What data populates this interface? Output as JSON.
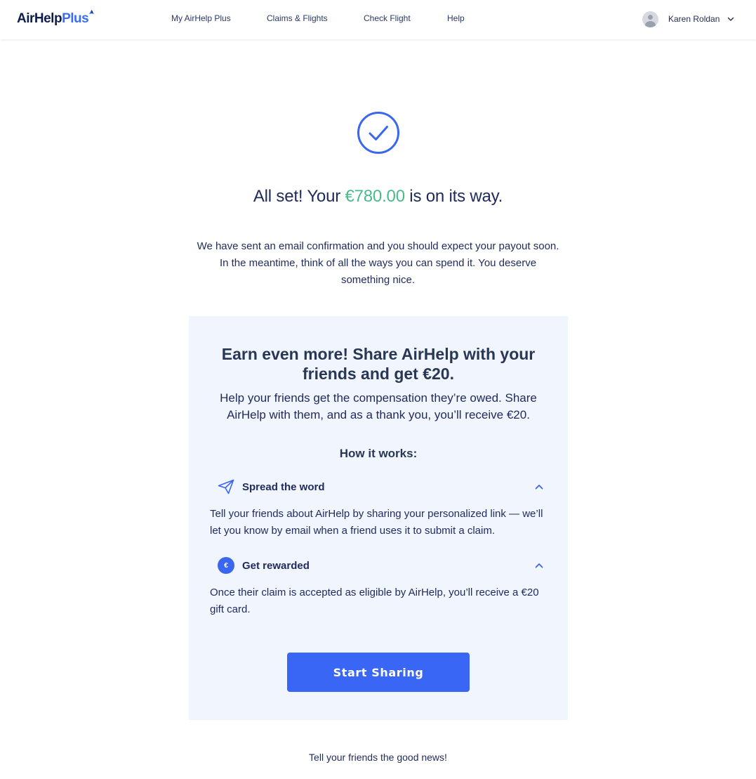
{
  "header": {
    "logo": {
      "primary": "AirHelp",
      "secondary": "Plus",
      "icon": "bird-logo-icon"
    },
    "nav": [
      {
        "label": "My AirHelp Plus"
      },
      {
        "label": "Claims & Flights"
      },
      {
        "label": "Check Flight"
      },
      {
        "label": "Help"
      }
    ],
    "user": {
      "name": "Karen Roldan",
      "avatar_icon": "user-avatar-icon",
      "menu_icon": "chevron-down-icon"
    }
  },
  "success": {
    "icon": "check-circle-icon",
    "headline_prefix": "All set! Your ",
    "amount": "€780.00",
    "headline_suffix": " is on its way.",
    "message": "We have sent an email confirmation and you should expect your payout soon. In the meantime, think of all the ways you can spend it. You deserve something nice."
  },
  "referral": {
    "title": "Earn even more! Share AirHelp with your friends and get €20.",
    "subtitle": "Help your friends get the compensation they’re owed. Share AirHelp with them, and as a thank you, you’ll receive €20.",
    "how_title": "How it works:",
    "steps": [
      {
        "icon": "paper-plane-icon",
        "title": "Spread the word",
        "text": "Tell your friends about AirHelp by sharing your personalized link — we’ll let you know by email when a friend uses it to submit a claim.",
        "toggle_icon": "chevron-up-icon"
      },
      {
        "icon": "euro-coin-icon",
        "icon_glyph": "€",
        "title": "Get rewarded",
        "text": "Once their claim is accepted as eligible by AirHelp, you’ll receive a €20 gift card.",
        "toggle_icon": "chevron-up-icon"
      }
    ],
    "cta_label": "Start Sharing"
  },
  "footer_note": "Tell your friends the good news!",
  "colors": {
    "accent": "#3a66f5",
    "amount": "#4bba8a",
    "card_bg": "#f1f5fd",
    "text": "#1f2a5c"
  }
}
